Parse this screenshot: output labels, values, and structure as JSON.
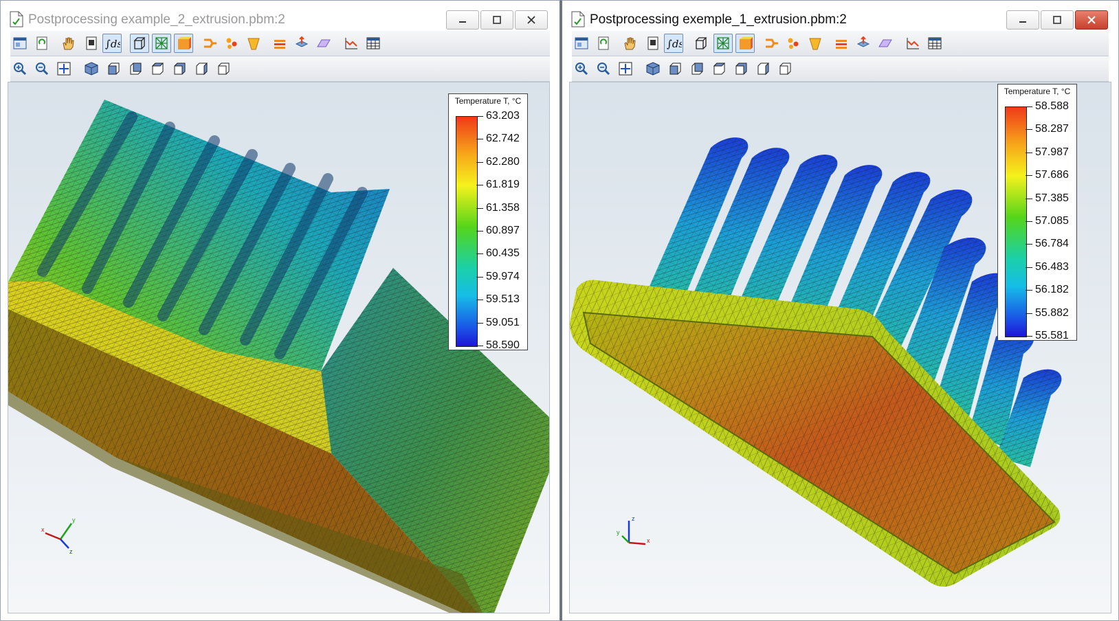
{
  "windows": [
    {
      "title": "Postprocessing example_2_extrusion.pbm:2",
      "active": false,
      "legend": {
        "title": "Temperature T, °C",
        "values": [
          "63.203",
          "62.742",
          "62.280",
          "61.819",
          "61.358",
          "60.897",
          "60.435",
          "59.974",
          "59.513",
          "59.051",
          "58.590"
        ]
      },
      "axes": {
        "x": "x",
        "y": "y",
        "z": "z"
      }
    },
    {
      "title": "Postprocessing exemple_1_extrusion.pbm:2",
      "active": true,
      "legend": {
        "title": "Temperature T, °C",
        "values": [
          "58.588",
          "58.287",
          "57.987",
          "57.686",
          "57.385",
          "57.085",
          "56.784",
          "56.483",
          "56.182",
          "55.882",
          "55.581"
        ]
      },
      "axes": {
        "x": "x",
        "y": "y",
        "z": "z"
      }
    }
  ],
  "toolbar_icons": [
    "view-icon",
    "refresh-icon",
    "pan-icon",
    "document-icon",
    "integral-ds-icon",
    "wireframe-icon",
    "mesh-icon",
    "shaded-icon",
    "flow-icon",
    "points-icon",
    "filter-icon",
    "layers-icon",
    "export-icon",
    "plane-icon",
    "chart-icon",
    "table-icon"
  ],
  "view_icons": [
    "zoom-in-icon",
    "zoom-out-icon",
    "fit-all-icon",
    "iso-view-icon",
    "front-view-icon",
    "back-view-icon",
    "top-view-icon",
    "bottom-view-icon",
    "left-view-icon",
    "right-view-icon"
  ],
  "colors": {
    "legend_top": "#ef3a18",
    "legend_bottom": "#1f14d8",
    "viewport_bg_top": "#d9e2ea",
    "viewport_bg_bottom": "#f4f6f8"
  }
}
